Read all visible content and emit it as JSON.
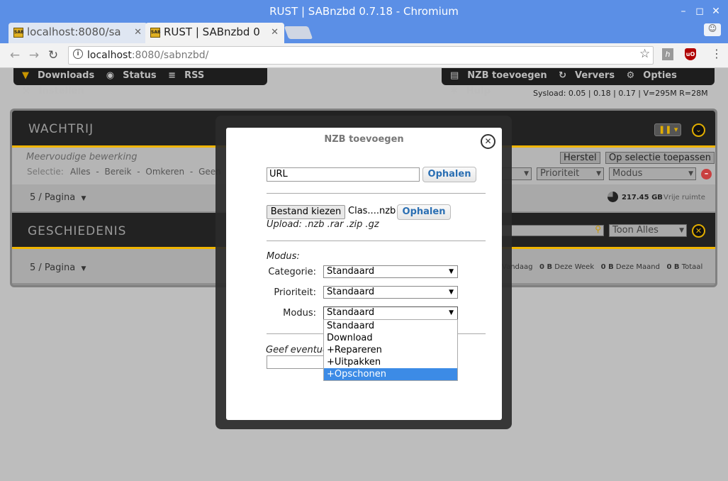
{
  "window": {
    "title": "RUST | SABnzbd 0.7.18 - Chromium"
  },
  "tabs": [
    {
      "label": "localhost:8080/sa"
    },
    {
      "label": "RUST | SABnzbd 0"
    }
  ],
  "address": {
    "host": "localhost",
    "path": ":8080/sabnzbd/"
  },
  "nav_left": [
    "Downloads",
    "Status",
    "RSS",
    "Instellen"
  ],
  "nav_right": [
    "NZB toevoegen",
    "Ververs",
    "Opties",
    "Hulp"
  ],
  "sysload": "Sysload: 0.05 | 0.18 | 0.17 | V=295M R=28M",
  "queue": {
    "title": "WACHTRIJ",
    "multi_edit": "Meervoudige bewerking",
    "selection_label": "Selectie:",
    "selection_items": [
      "Alles",
      "Bereik",
      "Omkeren",
      "Geen"
    ],
    "reset": "Herstel",
    "apply": "Op selectie toepassen",
    "priority": "Prioriteit",
    "mode": "Modus",
    "per_page": "5 / Pagina",
    "free_space": "217.45 GB",
    "free_space_label": "Vrije ruimte"
  },
  "history": {
    "title": "GESCHIEDENIS",
    "show_all": "Toon Alles",
    "per_page": "5 / Pagina",
    "today_label": "Vandaag",
    "week_value": "0 B",
    "week_label": "Deze Week",
    "month_value": "0 B",
    "month_label": "Deze Maand",
    "total_value": "0 B",
    "total_label": "Totaal"
  },
  "dialog": {
    "title": "NZB toevoegen",
    "url_value": "URL",
    "fetch1": "Ophalen",
    "choose_file": "Bestand kiezen",
    "file_name": "Clas....nzb",
    "fetch2": "Ophalen",
    "upload_hint": "Upload: .nzb .rar .zip .gz",
    "mode_heading": "Modus:",
    "category_label": "Categorie:",
    "category_value": "Standaard",
    "priority_label": "Prioriteit:",
    "priority_value": "Standaard",
    "mode_label": "Modus:",
    "mode_value": "Standaard",
    "name_hint": "Geef eventue",
    "mode_options": [
      "Standaard",
      "Download",
      "+Repareren",
      "+Uitpakken",
      "+Opschonen"
    ]
  }
}
